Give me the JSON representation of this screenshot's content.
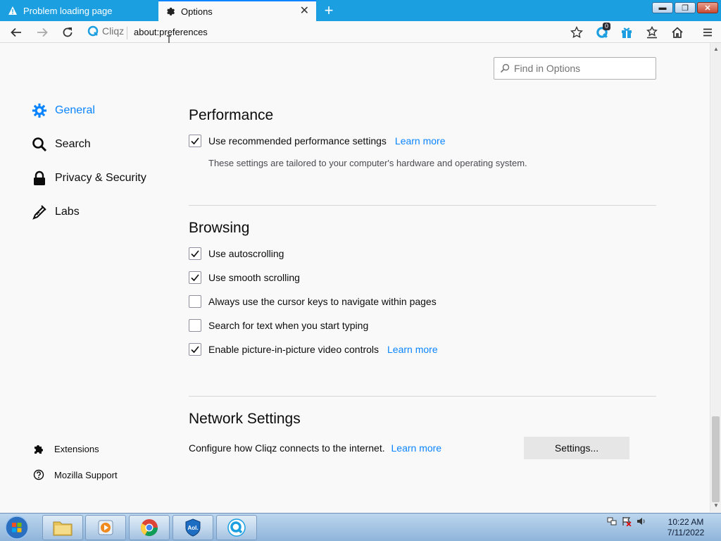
{
  "tabs": [
    {
      "title": "Problem loading page",
      "active": false,
      "icon": "warning-icon"
    },
    {
      "title": "Options",
      "active": true,
      "icon": "gear-icon"
    }
  ],
  "window_controls": {
    "minimize": "▬",
    "maximize": "❐",
    "close": "✕"
  },
  "toolbar": {
    "brand": "Cliqz",
    "url": "about:preferences",
    "notification_count": "0"
  },
  "search": {
    "placeholder": "Find in Options"
  },
  "categories": [
    {
      "label": "General",
      "icon": "gear-icon",
      "selected": true
    },
    {
      "label": "Search",
      "icon": "search-icon",
      "selected": false
    },
    {
      "label": "Privacy & Security",
      "icon": "lock-icon",
      "selected": false
    },
    {
      "label": "Labs",
      "icon": "flask-icon",
      "selected": false
    }
  ],
  "footer_links": [
    {
      "label": "Extensions",
      "icon": "puzzle-icon"
    },
    {
      "label": "Mozilla Support",
      "icon": "help-icon"
    }
  ],
  "performance": {
    "heading": "Performance",
    "recommended_label": "Use recommended performance settings",
    "recommended_checked": true,
    "learn_more": "Learn more",
    "description": "These settings are tailored to your computer's hardware and operating system."
  },
  "browsing": {
    "heading": "Browsing",
    "options": [
      {
        "label": "Use autoscrolling",
        "checked": true
      },
      {
        "label": "Use smooth scrolling",
        "checked": true
      },
      {
        "label": "Always use the cursor keys to navigate within pages",
        "checked": false
      },
      {
        "label": "Search for text when you start typing",
        "checked": false
      },
      {
        "label": "Enable picture-in-picture video controls",
        "checked": true
      }
    ],
    "pip_learn_more": "Learn more"
  },
  "network": {
    "heading": "Network Settings",
    "description": "Configure how Cliqz connects to the internet.",
    "learn_more": "Learn more",
    "button": "Settings..."
  },
  "taskbar": {
    "apps": [
      "file-explorer",
      "media-player",
      "chrome",
      "aol-shield",
      "cliqz"
    ],
    "time": "10:22 AM",
    "date": "7/11/2022"
  },
  "colors": {
    "accent": "#0a84ff",
    "tabbar": "#1c9fe0"
  }
}
